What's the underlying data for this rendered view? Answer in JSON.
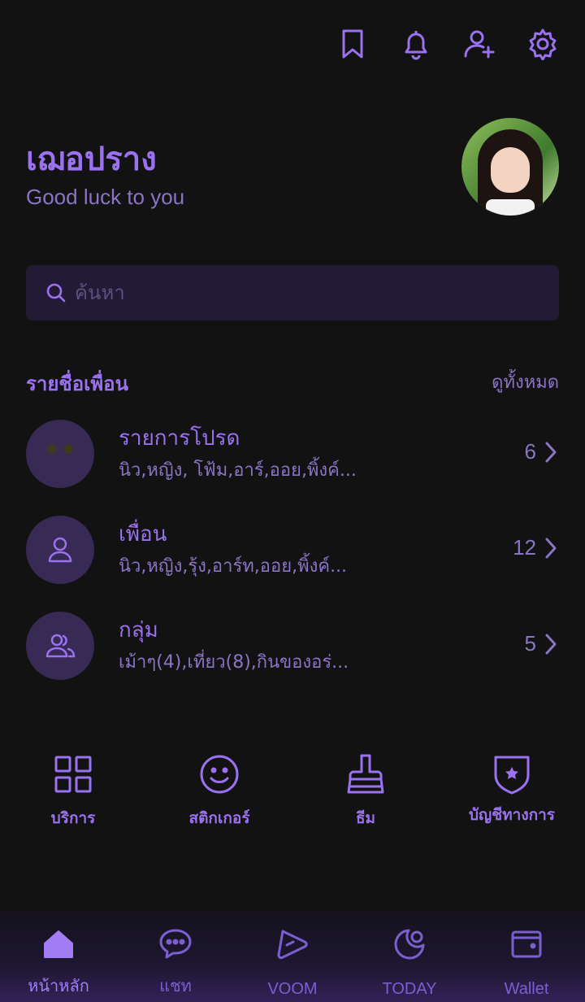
{
  "profile": {
    "name": "เฌอปราง",
    "status": "Good luck to you"
  },
  "search": {
    "placeholder": "ค้นหา"
  },
  "friends_section": {
    "title": "รายชื่อเพื่อน",
    "see_all": "ดูทั้งหมด",
    "rows": [
      {
        "label": "รายการโปรด",
        "members": "นิว,หญิง, โฟ้ม,อาร์,ออย,พิ้งค์...",
        "count": "6"
      },
      {
        "label": "เพื่อน",
        "members": "นิว,หญิง,รุ้ง,อาร์ท,ออย,พิ้งค์...",
        "count": "12"
      },
      {
        "label": "กลุ่ม",
        "members": "เม้าๆ(4),เที่ยว(8),กินของอร่...",
        "count": "5"
      }
    ]
  },
  "shortcuts": [
    {
      "label": "บริการ",
      "icon": "grid-icon"
    },
    {
      "label": "สติกเกอร์",
      "icon": "smiley-icon"
    },
    {
      "label": "ธีม",
      "icon": "brush-icon"
    },
    {
      "label": "บัญชีทางการ",
      "icon": "shield-star-icon"
    }
  ],
  "bottom_nav": [
    {
      "label": "หน้าหลัก",
      "icon": "home-icon",
      "active": true
    },
    {
      "label": "แชท",
      "icon": "chat-icon",
      "active": false
    },
    {
      "label": "VOOM",
      "icon": "voom-icon",
      "active": false
    },
    {
      "label": "TODAY",
      "icon": "today-icon",
      "active": false
    },
    {
      "label": "Wallet",
      "icon": "wallet-icon",
      "active": false
    }
  ],
  "colors": {
    "background": "#121212",
    "accent": "#9a72f0",
    "muted": "#8a74c4",
    "search_bg": "#231b35"
  }
}
